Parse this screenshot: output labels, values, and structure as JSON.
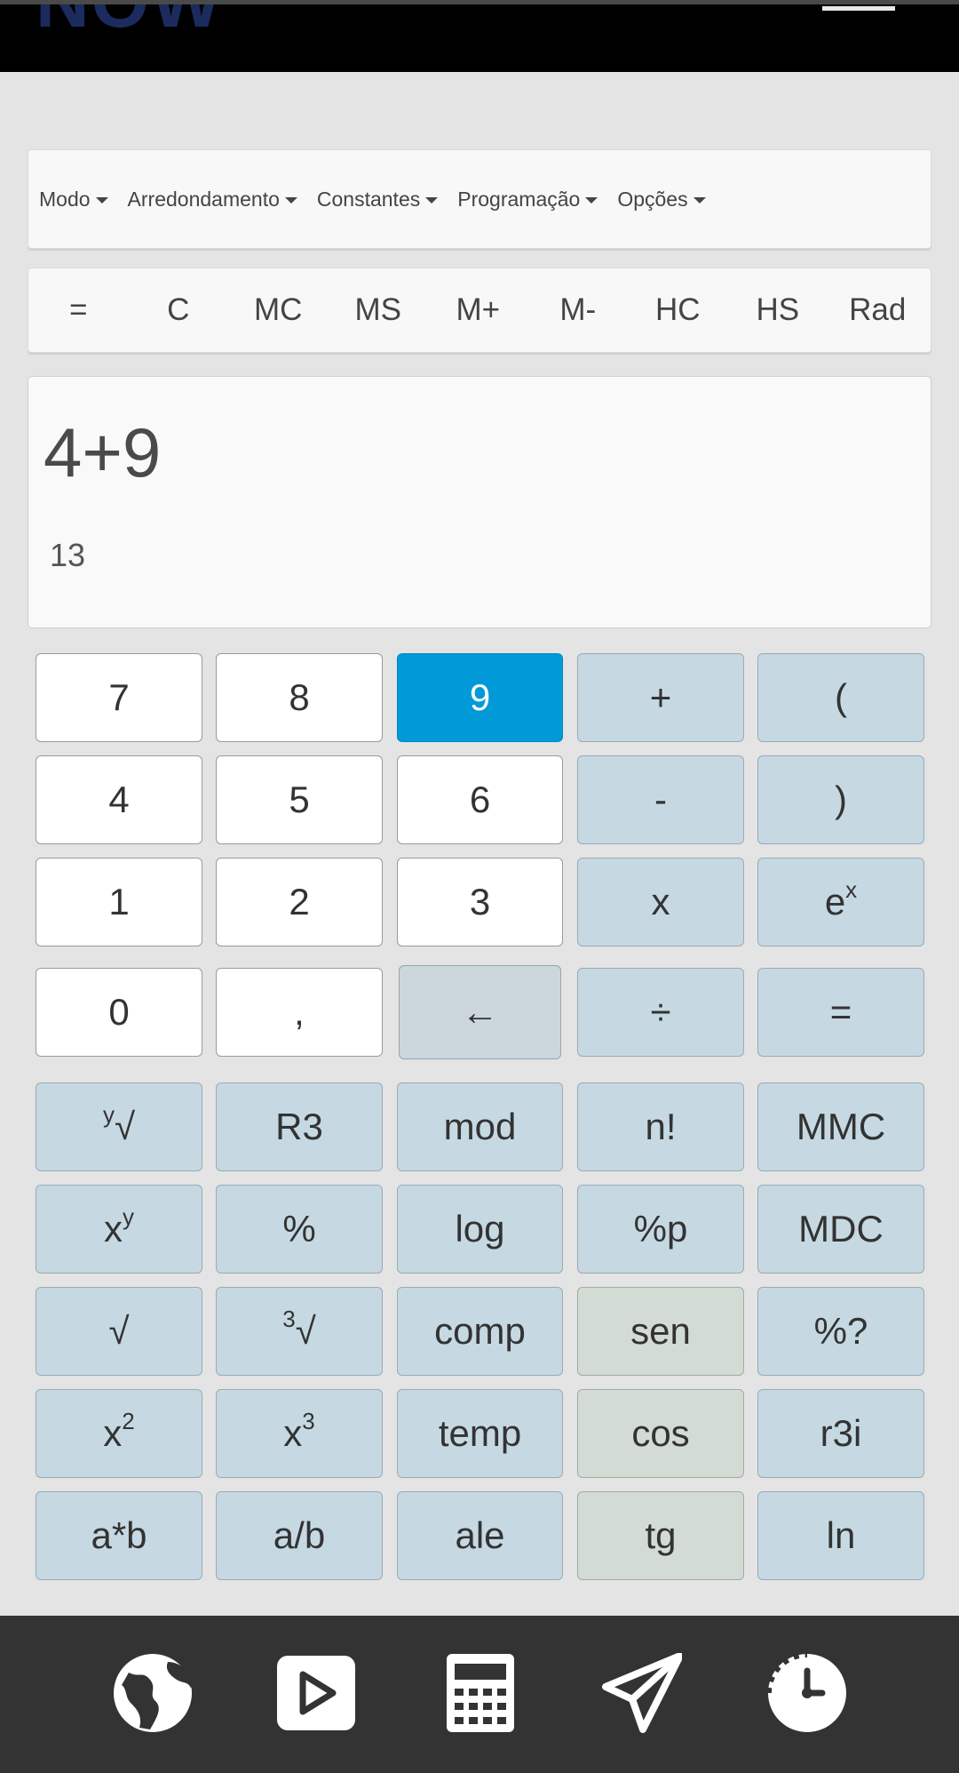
{
  "header": {
    "logo_text": "NOW"
  },
  "menus": [
    "Modo",
    "Arredondamento",
    "Constantes",
    "Programação",
    "Opções"
  ],
  "memory_buttons": [
    "=",
    "C",
    "MC",
    "MS",
    "M+",
    "M-",
    "HC",
    "HS",
    "Rad"
  ],
  "display": {
    "expression": "4+9",
    "result": "13"
  },
  "keys": {
    "k7": "7",
    "k8": "8",
    "k9": "9",
    "plus": "+",
    "lparen": "(",
    "k4": "4",
    "k5": "5",
    "k6": "6",
    "minus": "-",
    "rparen": ")",
    "k1": "1",
    "k2": "2",
    "k3": "3",
    "times": "x",
    "exp_base": "e",
    "exp_sup": "x",
    "k0": "0",
    "comma": ",",
    "backspace": "←",
    "divide": "÷",
    "equals": "=",
    "nroot_pre": "y",
    "nroot": "√",
    "r3": "R3",
    "mod": "mod",
    "fact": "n!",
    "mmc": "MMC",
    "pow_base": "x",
    "pow_sup": "y",
    "percent": "%",
    "log": "log",
    "percent_p": "%p",
    "mdc": "MDC",
    "sqrt": "√",
    "cbrt_pre": "3",
    "cbrt": "√",
    "comp": "comp",
    "sen": "sen",
    "percent_q": "%?",
    "sq_base": "x",
    "sq_sup": "2",
    "cube_base": "x",
    "cube_sup": "3",
    "temp": "temp",
    "cos": "cos",
    "r3i": "r3i",
    "axb": "a*b",
    "adivb": "a/b",
    "ale": "ale",
    "tg": "tg",
    "ln": "ln"
  },
  "bottom_nav": [
    "globe-icon",
    "play-icon",
    "calculator-icon",
    "send-icon",
    "timer-icon"
  ],
  "colors": {
    "active_key": "#0299d8",
    "op_key": "#c6d9e3",
    "trig_key": "#d3dbd5",
    "nav_bg": "#333333"
  }
}
